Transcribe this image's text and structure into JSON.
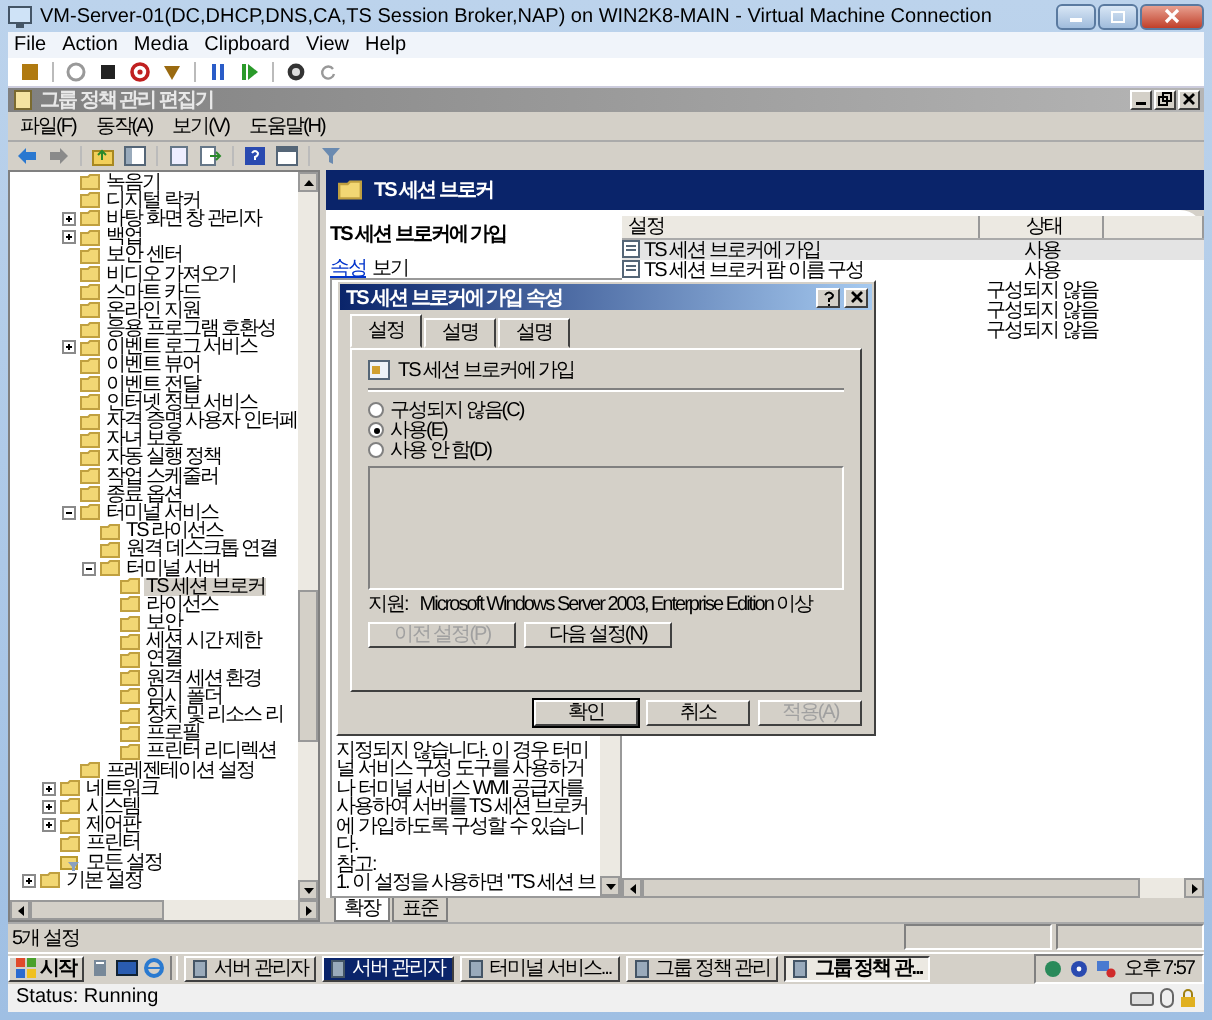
{
  "vm_window": {
    "title": "VM-Server-01(DC,DHCP,DNS,CA,TS Session Broker,NAP) on WIN2K8-MAIN - Virtual Machine Connection",
    "menu": [
      "File",
      "Action",
      "Media",
      "Clipboard",
      "View",
      "Help"
    ]
  },
  "app": {
    "title": "그룹 정책 관리 편집기",
    "menu": [
      "파일(F)",
      "동작(A)",
      "보기(V)",
      "도움말(H)"
    ]
  },
  "tree": {
    "branch_items": [
      {
        "label": "녹음기",
        "selected": false
      },
      {
        "label": "디지털 락커",
        "selected": false
      },
      {
        "label": "바탕 화면 창 관리자",
        "selected": false,
        "expanded": false
      },
      {
        "label": "백업",
        "selected": false,
        "expanded": false
      },
      {
        "label": "보안 센터",
        "selected": false
      },
      {
        "label": "비디오 가져오기",
        "selected": false
      },
      {
        "label": "스마트 카드",
        "selected": false
      },
      {
        "label": "온라인 지원",
        "selected": false
      },
      {
        "label": "응용 프로그램 호환성",
        "selected": false
      },
      {
        "label": "이벤트 로그 서비스",
        "selected": false,
        "expanded": false
      },
      {
        "label": "이벤트 뷰어",
        "selected": false
      },
      {
        "label": "이벤트 전달",
        "selected": false
      },
      {
        "label": "인터넷 정보 서비스",
        "selected": false
      },
      {
        "label": "자격 증명 사용자 인터페",
        "selected": false
      },
      {
        "label": "자녀 보호",
        "selected": false
      },
      {
        "label": "자동 실행 정책",
        "selected": false
      },
      {
        "label": "작업 스케줄러",
        "selected": false
      },
      {
        "label": "종료 옵션",
        "selected": false
      },
      {
        "label": "터미널 서비스",
        "selected": false,
        "expanded": true,
        "children": [
          {
            "label": "TS 라이선스",
            "selected": false
          },
          {
            "label": "원격 데스크톱 연결",
            "selected": false
          },
          {
            "label": "터미널 서버",
            "selected": false,
            "expanded": true,
            "children": [
              {
                "label": "TS 세션 브로커",
                "selected": true
              },
              {
                "label": "라이선스",
                "selected": false
              },
              {
                "label": "보안",
                "selected": false
              },
              {
                "label": "세션 시간 제한",
                "selected": false
              },
              {
                "label": "연결",
                "selected": false
              },
              {
                "label": "원격 세션 환경",
                "selected": false
              },
              {
                "label": "임시 폴더",
                "selected": false
              },
              {
                "label": "장치 및 리소스 리",
                "selected": false
              },
              {
                "label": "프로필",
                "selected": false
              },
              {
                "label": "프린터 리디렉션",
                "selected": false
              }
            ]
          }
        ]
      },
      {
        "label": "프레젠테이션 설정",
        "selected": false
      }
    ],
    "items": [
      {
        "label": "네트워크",
        "selected": false,
        "expanded": false
      },
      {
        "label": "시스템",
        "selected": false,
        "expanded": false
      },
      {
        "label": "제어판",
        "selected": false,
        "expanded": false
      },
      {
        "label": "프린터",
        "selected": false
      },
      {
        "label": "모든 설정",
        "selected": false,
        "kind": "filter"
      }
    ],
    "root_items": [
      {
        "label": "기본 설정",
        "selected": false,
        "expanded": false
      }
    ]
  },
  "details": {
    "header": "TS 세션 브로커",
    "description": {
      "title": "TS 세션 브로커에 가입",
      "link": "속성",
      "link_suffix": "보기",
      "text": "지정되지 않습니다. 이 경우 터미널 서비스 구성 도구를 사용하거나 터미널 서비스 WMI 공급자를 사용하여 서버를 TS 세션 브로커에 가입하도록 구성할 수 있습니다.",
      "note_heading": "참고:",
      "note": "1. 이 설정을 사용하면 \"TS 세션 브"
    },
    "list": {
      "columns": [
        "설정",
        "상태"
      ],
      "rows": [
        {
          "name": "TS 세션 브로커에 가입",
          "status": "사용",
          "selected": true
        },
        {
          "name": "TS 세션 브로커 팜 이름 구성",
          "status": "사용",
          "selected": false
        },
        {
          "status": "구성되지 않음",
          "selected": false
        },
        {
          "status": "구성되지 않음",
          "selected": false
        },
        {
          "status": "구성되지 않음",
          "selected": false
        }
      ]
    },
    "view_tabs": [
      {
        "label": "확장",
        "selected": true
      },
      {
        "label": "표준",
        "selected": false
      }
    ]
  },
  "dialog": {
    "title": "TS 세션 브로커에 가입 속성",
    "tabs": [
      {
        "label": "설정",
        "selected": true
      },
      {
        "label": "설명",
        "selected": false
      },
      {
        "label": "설명",
        "selected": false
      }
    ],
    "policy": "TS 세션 브로커에 가입",
    "options": [
      {
        "label": "구성되지 않음(C)",
        "selected": false
      },
      {
        "label": "사용(E)",
        "selected": true
      },
      {
        "label": "사용 안 함(D)",
        "selected": false
      }
    ],
    "support_label": "지원:",
    "support": "Microsoft Windows Server 2003, Enterprise Edition 이상",
    "nav_buttons": [
      {
        "label": "이전 설정(P)",
        "disabled": true
      },
      {
        "label": "다음 설정(N)",
        "disabled": false
      }
    ],
    "buttons": [
      {
        "label": "확인",
        "disabled": false,
        "default": true
      },
      {
        "label": "취소",
        "disabled": false,
        "default": false
      },
      {
        "label": "적용(A)",
        "disabled": true,
        "default": false
      }
    ]
  },
  "status_bar": "5개 설정",
  "taskbar": {
    "start": "시작",
    "buttons": [
      {
        "label": "서버 관리자",
        "selected": false,
        "highlighted": false
      },
      {
        "label": "서버 관리자",
        "selected": false,
        "highlighted": true
      },
      {
        "label": "터미널 서비스...",
        "selected": false,
        "highlighted": false
      },
      {
        "label": "그룹 정책 관리",
        "selected": false,
        "highlighted": false
      },
      {
        "label": "그룹 정책 관...",
        "selected": true,
        "highlighted": false
      }
    ],
    "clock": "오후 7:57"
  },
  "vm_status": "Status: Running"
}
